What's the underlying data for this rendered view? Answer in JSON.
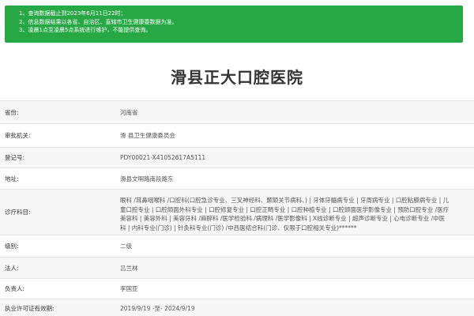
{
  "notice": {
    "lines": [
      "1、查询数据截止到2023年6月11日22时；",
      "2、信息数据结果以各省、自治区、直辖市卫生健康委数据为准。",
      "3、凌晨1点至凌晨5点系统进行维护，不能提供查询。"
    ],
    "bg_color": "#27a844"
  },
  "hospital": {
    "name": "滑县正大口腔医院"
  },
  "info": {
    "province": {
      "label": "省份:",
      "value": "河南省"
    },
    "authority": {
      "label": "审批机关:",
      "value": "滑 县卫生健康委员会"
    },
    "registration": {
      "label": "登记号:",
      "value": "PDY00021-X41052617A5111"
    },
    "address": {
      "label": "地址:",
      "value": "滑县文明路南段路东"
    },
    "subjects": {
      "label": "诊疗科目:",
      "value": "眼科 /耳鼻咽喉科 /口腔科(口腔急诊专业、三叉神经科、颞颌关节病科、) | 牙体牙髓病专业 | 牙周病专业 | 口腔粘膜病专业 | 儿童口腔专业 | 口腔颌面外科专业 | 口腔修复专业 | 口腔正畸专业 | 口腔种植专业 | 口腔颌面医学影像专业 | 预防口腔专业 /医疗美容科 | 美容外科 | 美容牙科 /麻醉科 /医学检验科 /病理科 /医学影像科 | X线诊断专业 | 超声诊断专业 | 心电诊断专业 /中医科 | 内科专业(门诊) | 针灸科专业(门诊) /中西医结合科(门诊、仅限于口腔相关专业)******"
    },
    "grade": {
      "label": "级别:",
      "value": "二级"
    },
    "legal_rep": {
      "label": "法人:",
      "value": "吕兰林"
    },
    "principal": {
      "label": "负责人:",
      "value": "李国亚"
    },
    "validity": {
      "label": "执业许可证有效期:",
      "value": "2019/9/19 -至- 2024/9/19"
    }
  }
}
